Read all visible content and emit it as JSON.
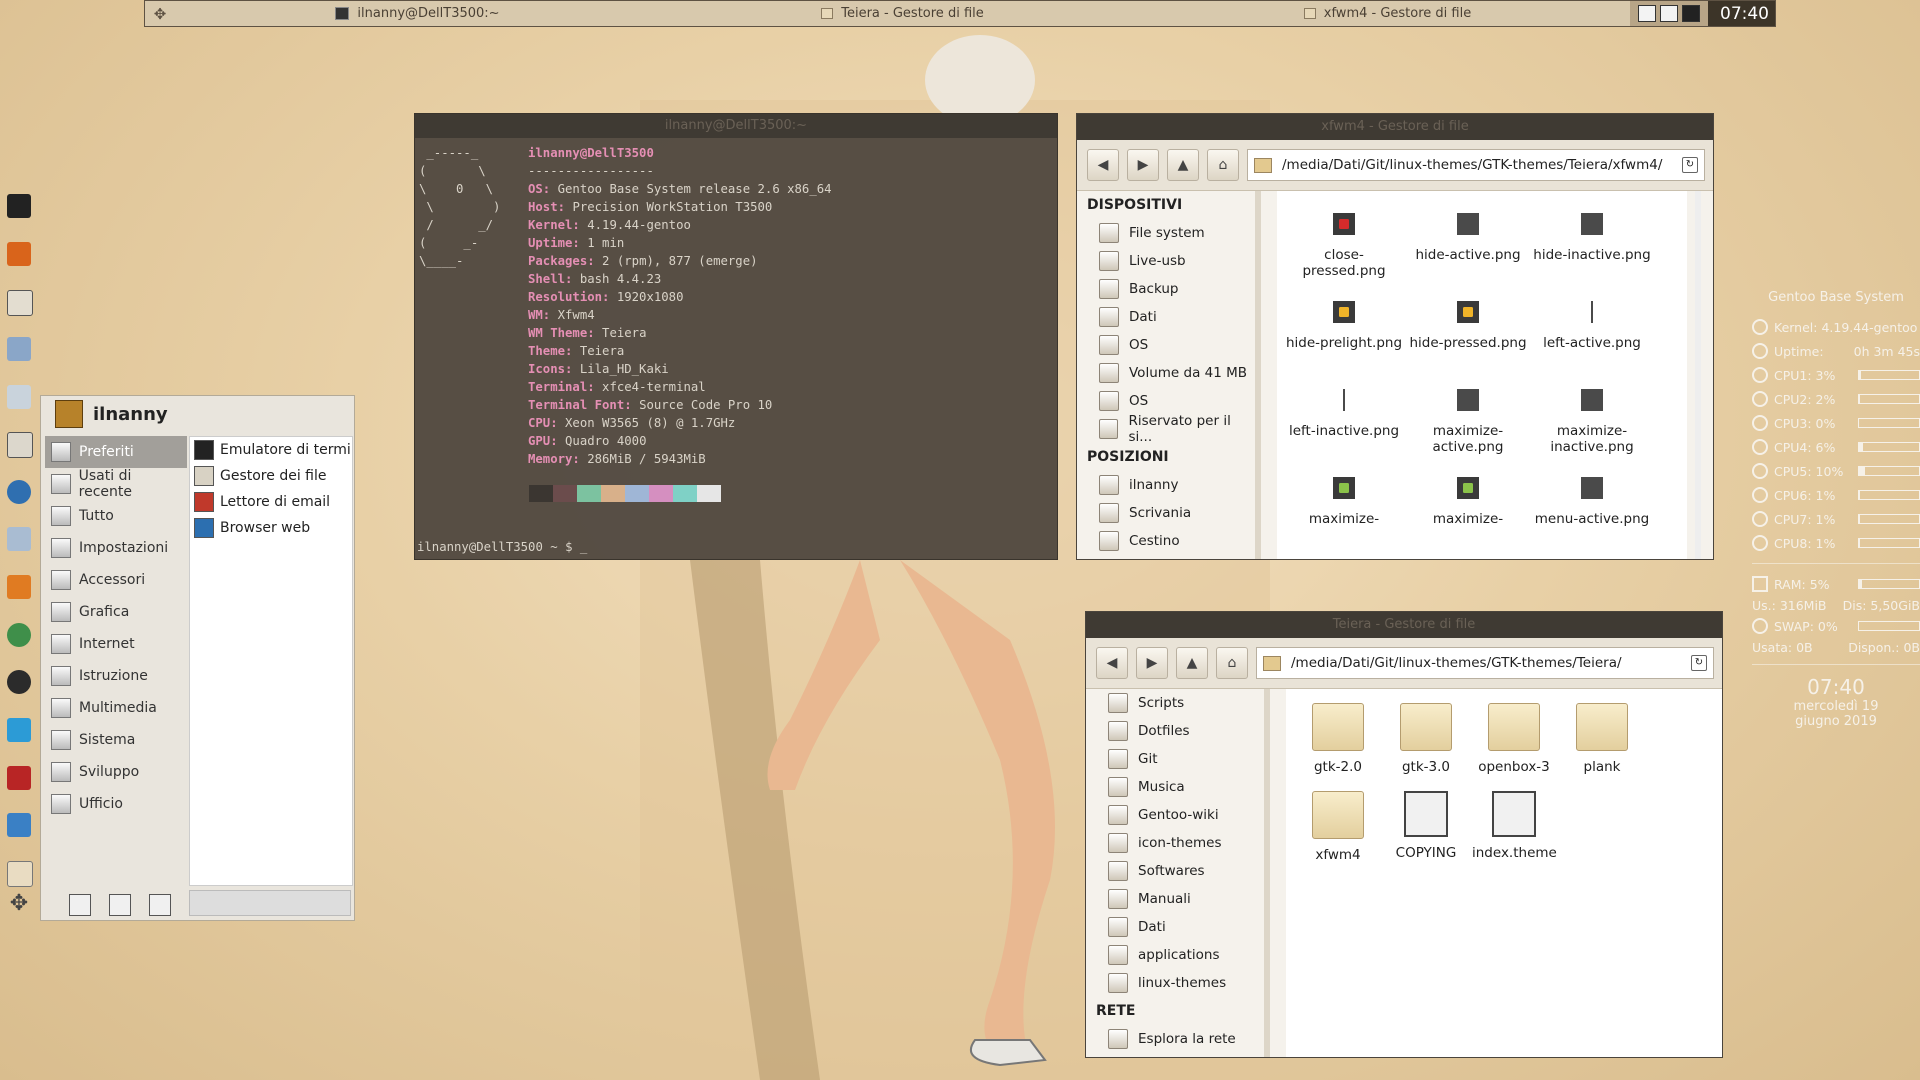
{
  "top_panel": {
    "tasks": [
      {
        "label": "ilnanny@DellT3500:~"
      },
      {
        "label": "Teiera - Gestore di file"
      },
      {
        "label": "xfwm4 - Gestore di file"
      }
    ],
    "clock": "07:40"
  },
  "terminal": {
    "title": "ilnanny@DellT3500:~",
    "user_host": "ilnanny@DellT3500",
    "divider": "-----------------",
    "info": [
      {
        "key": "OS:",
        "value": "Gentoo Base System release 2.6 x86_64"
      },
      {
        "key": "Host:",
        "value": "Precision WorkStation T3500"
      },
      {
        "key": "Kernel:",
        "value": "4.19.44-gentoo"
      },
      {
        "key": "Uptime:",
        "value": "1 min"
      },
      {
        "key": "Packages:",
        "value": "2 (rpm), 877 (emerge)"
      },
      {
        "key": "Shell:",
        "value": "bash 4.4.23"
      },
      {
        "key": "Resolution:",
        "value": "1920x1080"
      },
      {
        "key": "WM:",
        "value": "Xfwm4"
      },
      {
        "key": "WM Theme:",
        "value": "Teiera"
      },
      {
        "key": "Theme:",
        "value": "Teiera"
      },
      {
        "key": "Icons:",
        "value": "Lila_HD_Kaki"
      },
      {
        "key": "Terminal:",
        "value": "xfce4-terminal"
      },
      {
        "key": "Terminal Font:",
        "value": "Source Code Pro 10"
      },
      {
        "key": "CPU:",
        "value": "Xeon W3565 (8) @ 1.7GHz"
      },
      {
        "key": "GPU:",
        "value": "Quadro 4000"
      },
      {
        "key": "Memory:",
        "value": "286MiB / 5943MiB"
      }
    ],
    "swatch_colors": [
      "#3b3631",
      "#6b4c4c",
      "#7cc2a0",
      "#d8b08a",
      "#9fb6d6",
      "#d58fc0",
      "#7fd1c6",
      "#e6e6e6"
    ],
    "prompt": "ilnanny@DellT3500 ~ $ _"
  },
  "fm_top": {
    "title": "xfwm4 - Gestore di file",
    "path": "/media/Dati/Git/linux-themes/GTK-themes/Teiera/xfwm4/",
    "sections": [
      {
        "heading": "DISPOSITIVI",
        "items": [
          "File system",
          "Live-usb",
          "Backup",
          "Dati",
          "OS",
          "Volume da 41 MB",
          "OS",
          "Riservato per il si..."
        ]
      },
      {
        "heading": "POSIZIONI",
        "items": [
          "ilnanny",
          "Scrivania",
          "Cestino"
        ]
      }
    ],
    "files": [
      {
        "name": "close-pressed.png",
        "color": "#d42b2b"
      },
      {
        "name": "hide-active.png",
        "color": "#4a4a4a"
      },
      {
        "name": "hide-inactive.png",
        "color": "#4a4a4a"
      },
      {
        "name": "hide-prelight.png",
        "color": "#f0b429"
      },
      {
        "name": "hide-pressed.png",
        "color": "#f0b429"
      },
      {
        "name": "left-active.png",
        "color": "#4a4a4a"
      },
      {
        "name": "left-inactive.png",
        "color": "#4a4a4a"
      },
      {
        "name": "maximize-active.png",
        "color": "#4a4a4a"
      },
      {
        "name": "maximize-inactive.png",
        "color": "#4a4a4a"
      },
      {
        "name": "maximize-",
        "color": "#8bc34a"
      },
      {
        "name": "maximize-",
        "color": "#8bc34a"
      },
      {
        "name": "menu-active.png",
        "color": "#4a4a4a"
      }
    ]
  },
  "fm_bottom": {
    "title": "Teiera - Gestore di file",
    "path": "/media/Dati/Git/linux-themes/GTK-themes/Teiera/",
    "side_items": [
      "Scripts",
      "Dotfiles",
      "Git",
      "Musica",
      "Gentoo-wiki",
      "icon-themes",
      "Softwares",
      "Manuali",
      "Dati",
      "applications",
      "linux-themes"
    ],
    "network_heading": "RETE",
    "network_items": [
      "Esplora la rete"
    ],
    "files": [
      {
        "name": "gtk-2.0",
        "kind": "folder"
      },
      {
        "name": "gtk-3.0",
        "kind": "folder"
      },
      {
        "name": "openbox-3",
        "kind": "folder"
      },
      {
        "name": "plank",
        "kind": "folder"
      },
      {
        "name": "xfwm4",
        "kind": "folder"
      },
      {
        "name": "COPYING",
        "kind": "doc"
      },
      {
        "name": "index.theme",
        "kind": "doc"
      }
    ]
  },
  "app_menu": {
    "username": "ilnanny",
    "categories": [
      "Preferiti",
      "Usati di recente",
      "Tutto",
      "Impostazioni",
      "Accessori",
      "Grafica",
      "Internet",
      "Istruzione",
      "Multimedia",
      "Sistema",
      "Sviluppo",
      "Ufficio"
    ],
    "selected_category": "Preferiti",
    "apps": [
      "Emulatore di termin...",
      "Gestore dei file",
      "Lettore di email",
      "Browser web"
    ]
  },
  "conky": {
    "header": "Gentoo Base System",
    "kernel": "Kernel: 4.19.44-gentoo",
    "uptime_label": "Uptime:",
    "uptime_value": "0h 3m 45s",
    "cpus": [
      {
        "label": "CPU1: 3%",
        "pct": 3
      },
      {
        "label": "CPU2: 2%",
        "pct": 2
      },
      {
        "label": "CPU3: 0%",
        "pct": 0
      },
      {
        "label": "CPU4: 6%",
        "pct": 6
      },
      {
        "label": "CPU5: 10%",
        "pct": 10
      },
      {
        "label": "CPU6: 1%",
        "pct": 1
      },
      {
        "label": "CPU7: 1%",
        "pct": 1
      },
      {
        "label": "CPU8: 1%",
        "pct": 1
      }
    ],
    "ram": {
      "label": "RAM: 5%",
      "pct": 5
    },
    "ram_used": "Us.: 316MiB",
    "ram_avail": "Dis: 5,50GiB",
    "swap": {
      "label": "SWAP: 0%",
      "pct": 0
    },
    "swap_used": "Usata: 0B",
    "swap_avail": "Dispon.: 0B",
    "clock": "07:40",
    "day": "mercoledì 19",
    "month": "giugno 2019"
  }
}
